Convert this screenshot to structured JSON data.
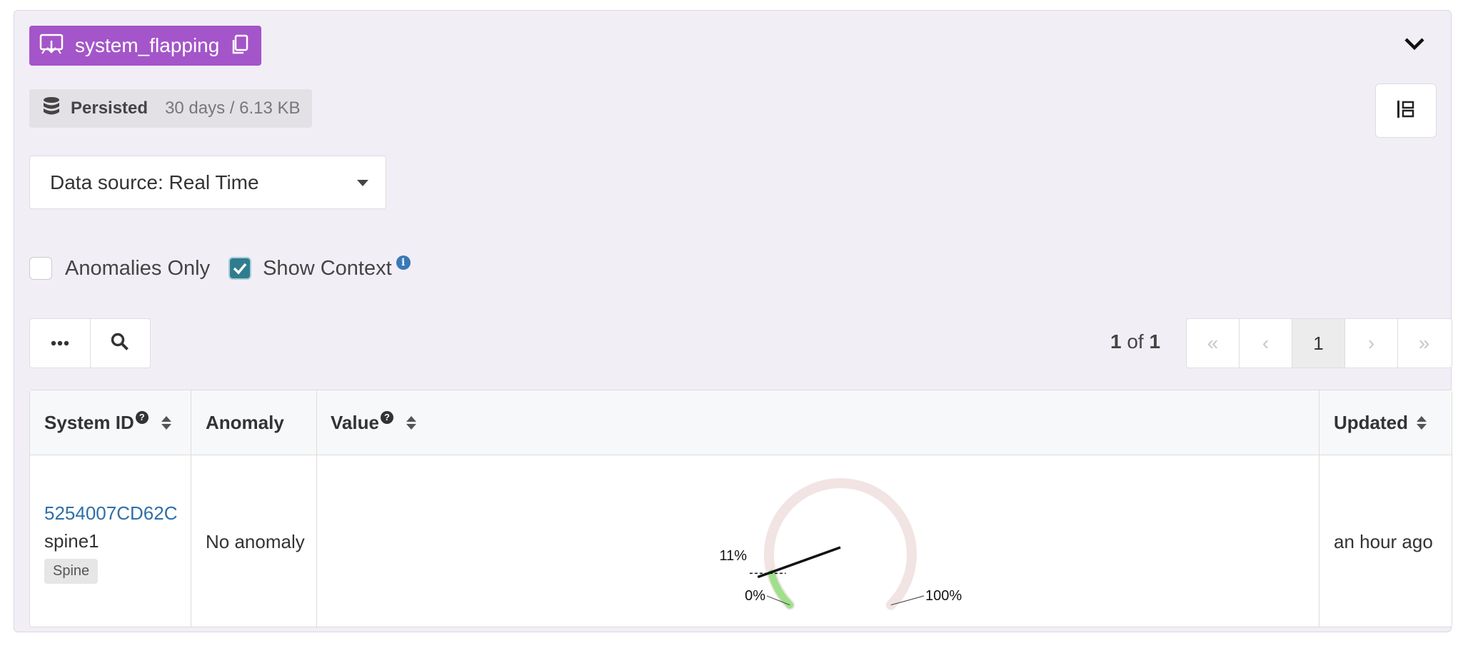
{
  "probe": {
    "name": "system_flapping"
  },
  "persistence": {
    "label": "Persisted",
    "detail": "30 days / 6.13 KB"
  },
  "data_source": {
    "label": "Data source: Real Time"
  },
  "filters": {
    "anomalies_only": "Anomalies Only",
    "show_context": "Show Context",
    "anomalies_checked": false,
    "context_checked": true
  },
  "pagination": {
    "current": "1",
    "total": "1",
    "of_label": "of",
    "pages": [
      "1"
    ]
  },
  "table": {
    "columns": [
      "System ID",
      "Anomaly",
      "Value",
      "Updated"
    ],
    "rows": [
      {
        "system_id": "5254007CD62C",
        "hostname": "spine1",
        "role": "Spine",
        "anomaly": "No anomaly",
        "updated": "an hour ago",
        "gauge": {
          "value_percent": 11,
          "label_value": "11%",
          "min_label": "0%",
          "max_label": "100%"
        }
      }
    ]
  },
  "colors": {
    "probe_tag": "#a455c9",
    "link": "#2e6fa8",
    "checkbox_on": "#2f7d8e",
    "gauge_ok": "#9ee08b"
  }
}
